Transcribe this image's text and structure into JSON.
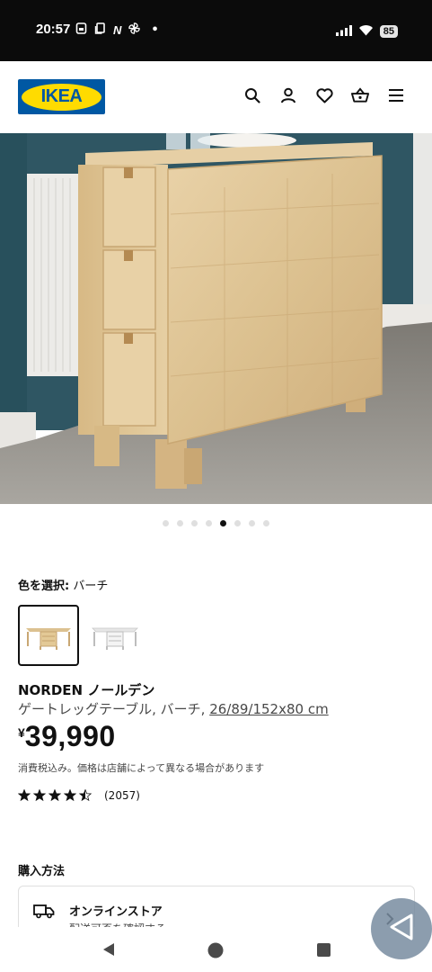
{
  "status_bar": {
    "time": "20:57",
    "left_icons": [
      "sim-card-icon",
      "copy-icon",
      "n-app-icon",
      "pinwheel-icon",
      "dot"
    ],
    "n_label": "N",
    "dot_label": "•",
    "battery": "85"
  },
  "header": {
    "logo_text": "IKEA",
    "icons": [
      "search-icon",
      "user-icon",
      "heart-icon",
      "basket-icon",
      "menu-icon"
    ]
  },
  "carousel": {
    "dot_count": 8,
    "active_index": 4
  },
  "color": {
    "label": "色を選択:",
    "value": "バーチ",
    "swatches": [
      "birch",
      "white"
    ]
  },
  "product": {
    "name": "NORDEN ノールデン",
    "desc": "ゲートレッグテーブル, バーチ, ",
    "dimensions": "26/89/152x80 cm",
    "currency": "¥",
    "price": "39,990",
    "tax_note": "消費税込み。価格は店舗によって異なる場合があります",
    "rating": 4.5,
    "review_count": "(2057)"
  },
  "purchase": {
    "title": "購入方法",
    "online_title": "オンラインストア",
    "online_sub": "配送可否を確認する"
  },
  "colors": {
    "ikea_blue": "#0058a3",
    "ikea_yellow": "#ffdb00"
  }
}
